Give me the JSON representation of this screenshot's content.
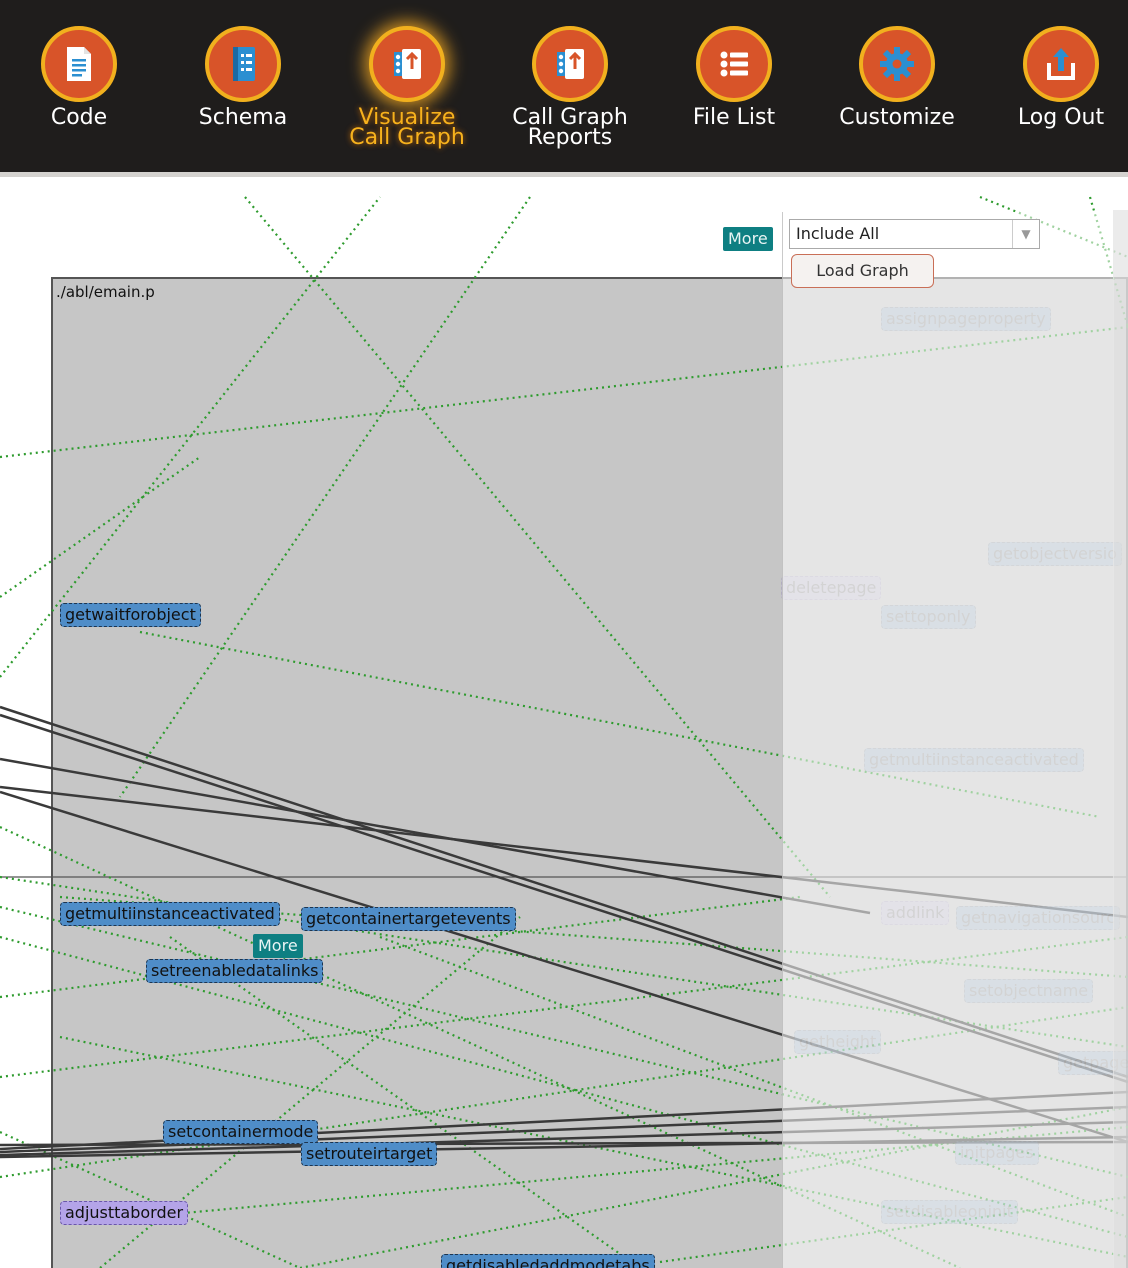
{
  "nav": {
    "items": [
      {
        "label_1": "Code",
        "label_2": "",
        "icon": "document-icon"
      },
      {
        "label_1": "Schema",
        "label_2": "",
        "icon": "schema-book-icon"
      },
      {
        "label_1": "Visualize",
        "label_2": "Call Graph",
        "icon": "call-graph-icon",
        "active": true
      },
      {
        "label_1": "Call Graph",
        "label_2": "Reports",
        "icon": "call-graph-report-icon"
      },
      {
        "label_1": "File List",
        "label_2": "",
        "icon": "list-icon"
      },
      {
        "label_1": "Customize",
        "label_2": "",
        "icon": "gear-icon"
      },
      {
        "label_1": "Log Out",
        "label_2": "",
        "icon": "logout-icon"
      }
    ],
    "colors": {
      "bar": "#1f1d1c",
      "icon_fill": "#d85429",
      "icon_ring": "#f1b01e",
      "active_label": "#f7b21d"
    }
  },
  "controls": {
    "filter_select_value": "Include All",
    "load_button_label": "Load Graph"
  },
  "graph": {
    "file_label": "./abl/emain.p",
    "more_labels": [
      "More",
      "More"
    ],
    "nodes": {
      "getwaitforobject": "getwaitforobject",
      "getmultiinstanceactivated": "getmultiinstanceactivated",
      "getcontainertargetevents": "getcontainertargetevents",
      "setreenabledatalinks": "setreenabledatalinks",
      "adjusttaborder": "adjusttaborder",
      "setcontainermode": "setcontainermode",
      "setrouteirtarget": "setrouteirtarget",
      "getdisabledaddmodetabs": "getdisabledaddmodetabs",
      "assignpageproperty": "assignpageproperty",
      "getobjectversion": "getobjectversio",
      "deletepage": "deletepage",
      "settopoonly": "settoponly",
      "getmultiinstanceactivated_faded": "getmultiinstanceactivated",
      "addlink": "addlink",
      "getnavigationsource": "getnavigationsourc",
      "setobjectname": "setobjectname",
      "getheight": "getheight",
      "getpagec": "getpage",
      "initpages": "initpages",
      "setdisableoninit": "setdisableoninit"
    },
    "colors": {
      "node_blue": "#4f8dc8",
      "node_purple": "#b4a4e8",
      "more_teal": "#0e7f82",
      "call_green": "#2e9b2e",
      "file_box": "#c6c6c6"
    }
  }
}
